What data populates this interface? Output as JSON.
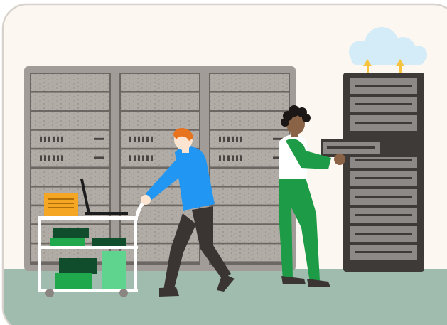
{
  "illustration": {
    "subject": "server-room-illustration",
    "colors": {
      "background": "#fdf7f2",
      "border": "#d8d2cc",
      "floor": "#9fbcae",
      "rack_frame": "#a19c97",
      "rack_panel": "#b0aba5",
      "rack_line": "#6d6763",
      "cloud_rack_frame": "#3d3a38",
      "cloud_rack_panel": "#8d8986",
      "cloud": "#d3ecf8",
      "arrow": "#f5c33d",
      "person_shirt_blue": "#2196f3",
      "person_pants_dark": "#3a3533",
      "person_hair_orange": "#e8731e",
      "person_skin_light": "#fde4d0",
      "person_shirt_green": "#1e9b46",
      "person_skin_dark": "#8a6245",
      "person_hair_black": "#1b1716",
      "cart": "#ffffff",
      "green_dark": "#0f4d2c",
      "green_mid": "#20a84c",
      "green_light": "#5fd48f",
      "folder": "#f5a623",
      "laptop": "#1d1d1d"
    },
    "icons": [
      "cloud-icon",
      "upload-arrow-icon",
      "server-rack-icon",
      "laptop-icon",
      "folder-icon"
    ]
  }
}
